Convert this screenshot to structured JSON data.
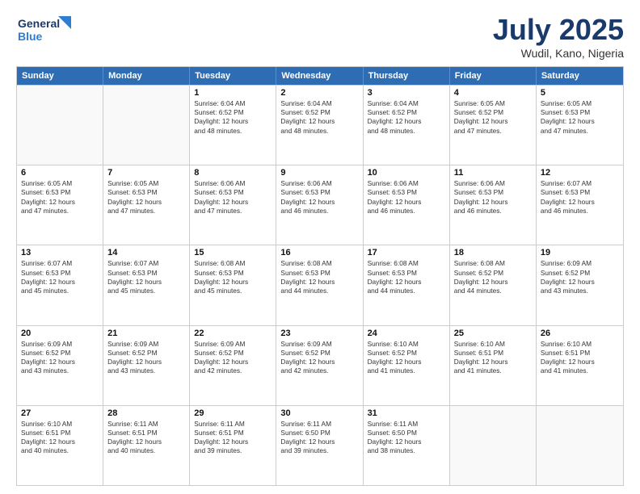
{
  "header": {
    "logo_general": "General",
    "logo_blue": "Blue",
    "month": "July 2025",
    "location": "Wudil, Kano, Nigeria"
  },
  "weekdays": [
    "Sunday",
    "Monday",
    "Tuesday",
    "Wednesday",
    "Thursday",
    "Friday",
    "Saturday"
  ],
  "rows": [
    [
      {
        "day": "",
        "lines": []
      },
      {
        "day": "",
        "lines": []
      },
      {
        "day": "1",
        "lines": [
          "Sunrise: 6:04 AM",
          "Sunset: 6:52 PM",
          "Daylight: 12 hours",
          "and 48 minutes."
        ]
      },
      {
        "day": "2",
        "lines": [
          "Sunrise: 6:04 AM",
          "Sunset: 6:52 PM",
          "Daylight: 12 hours",
          "and 48 minutes."
        ]
      },
      {
        "day": "3",
        "lines": [
          "Sunrise: 6:04 AM",
          "Sunset: 6:52 PM",
          "Daylight: 12 hours",
          "and 48 minutes."
        ]
      },
      {
        "day": "4",
        "lines": [
          "Sunrise: 6:05 AM",
          "Sunset: 6:52 PM",
          "Daylight: 12 hours",
          "and 47 minutes."
        ]
      },
      {
        "day": "5",
        "lines": [
          "Sunrise: 6:05 AM",
          "Sunset: 6:53 PM",
          "Daylight: 12 hours",
          "and 47 minutes."
        ]
      }
    ],
    [
      {
        "day": "6",
        "lines": [
          "Sunrise: 6:05 AM",
          "Sunset: 6:53 PM",
          "Daylight: 12 hours",
          "and 47 minutes."
        ]
      },
      {
        "day": "7",
        "lines": [
          "Sunrise: 6:05 AM",
          "Sunset: 6:53 PM",
          "Daylight: 12 hours",
          "and 47 minutes."
        ]
      },
      {
        "day": "8",
        "lines": [
          "Sunrise: 6:06 AM",
          "Sunset: 6:53 PM",
          "Daylight: 12 hours",
          "and 47 minutes."
        ]
      },
      {
        "day": "9",
        "lines": [
          "Sunrise: 6:06 AM",
          "Sunset: 6:53 PM",
          "Daylight: 12 hours",
          "and 46 minutes."
        ]
      },
      {
        "day": "10",
        "lines": [
          "Sunrise: 6:06 AM",
          "Sunset: 6:53 PM",
          "Daylight: 12 hours",
          "and 46 minutes."
        ]
      },
      {
        "day": "11",
        "lines": [
          "Sunrise: 6:06 AM",
          "Sunset: 6:53 PM",
          "Daylight: 12 hours",
          "and 46 minutes."
        ]
      },
      {
        "day": "12",
        "lines": [
          "Sunrise: 6:07 AM",
          "Sunset: 6:53 PM",
          "Daylight: 12 hours",
          "and 46 minutes."
        ]
      }
    ],
    [
      {
        "day": "13",
        "lines": [
          "Sunrise: 6:07 AM",
          "Sunset: 6:53 PM",
          "Daylight: 12 hours",
          "and 45 minutes."
        ]
      },
      {
        "day": "14",
        "lines": [
          "Sunrise: 6:07 AM",
          "Sunset: 6:53 PM",
          "Daylight: 12 hours",
          "and 45 minutes."
        ]
      },
      {
        "day": "15",
        "lines": [
          "Sunrise: 6:08 AM",
          "Sunset: 6:53 PM",
          "Daylight: 12 hours",
          "and 45 minutes."
        ]
      },
      {
        "day": "16",
        "lines": [
          "Sunrise: 6:08 AM",
          "Sunset: 6:53 PM",
          "Daylight: 12 hours",
          "and 44 minutes."
        ]
      },
      {
        "day": "17",
        "lines": [
          "Sunrise: 6:08 AM",
          "Sunset: 6:53 PM",
          "Daylight: 12 hours",
          "and 44 minutes."
        ]
      },
      {
        "day": "18",
        "lines": [
          "Sunrise: 6:08 AM",
          "Sunset: 6:52 PM",
          "Daylight: 12 hours",
          "and 44 minutes."
        ]
      },
      {
        "day": "19",
        "lines": [
          "Sunrise: 6:09 AM",
          "Sunset: 6:52 PM",
          "Daylight: 12 hours",
          "and 43 minutes."
        ]
      }
    ],
    [
      {
        "day": "20",
        "lines": [
          "Sunrise: 6:09 AM",
          "Sunset: 6:52 PM",
          "Daylight: 12 hours",
          "and 43 minutes."
        ]
      },
      {
        "day": "21",
        "lines": [
          "Sunrise: 6:09 AM",
          "Sunset: 6:52 PM",
          "Daylight: 12 hours",
          "and 43 minutes."
        ]
      },
      {
        "day": "22",
        "lines": [
          "Sunrise: 6:09 AM",
          "Sunset: 6:52 PM",
          "Daylight: 12 hours",
          "and 42 minutes."
        ]
      },
      {
        "day": "23",
        "lines": [
          "Sunrise: 6:09 AM",
          "Sunset: 6:52 PM",
          "Daylight: 12 hours",
          "and 42 minutes."
        ]
      },
      {
        "day": "24",
        "lines": [
          "Sunrise: 6:10 AM",
          "Sunset: 6:52 PM",
          "Daylight: 12 hours",
          "and 41 minutes."
        ]
      },
      {
        "day": "25",
        "lines": [
          "Sunrise: 6:10 AM",
          "Sunset: 6:51 PM",
          "Daylight: 12 hours",
          "and 41 minutes."
        ]
      },
      {
        "day": "26",
        "lines": [
          "Sunrise: 6:10 AM",
          "Sunset: 6:51 PM",
          "Daylight: 12 hours",
          "and 41 minutes."
        ]
      }
    ],
    [
      {
        "day": "27",
        "lines": [
          "Sunrise: 6:10 AM",
          "Sunset: 6:51 PM",
          "Daylight: 12 hours",
          "and 40 minutes."
        ]
      },
      {
        "day": "28",
        "lines": [
          "Sunrise: 6:11 AM",
          "Sunset: 6:51 PM",
          "Daylight: 12 hours",
          "and 40 minutes."
        ]
      },
      {
        "day": "29",
        "lines": [
          "Sunrise: 6:11 AM",
          "Sunset: 6:51 PM",
          "Daylight: 12 hours",
          "and 39 minutes."
        ]
      },
      {
        "day": "30",
        "lines": [
          "Sunrise: 6:11 AM",
          "Sunset: 6:50 PM",
          "Daylight: 12 hours",
          "and 39 minutes."
        ]
      },
      {
        "day": "31",
        "lines": [
          "Sunrise: 6:11 AM",
          "Sunset: 6:50 PM",
          "Daylight: 12 hours",
          "and 38 minutes."
        ]
      },
      {
        "day": "",
        "lines": []
      },
      {
        "day": "",
        "lines": []
      }
    ]
  ]
}
